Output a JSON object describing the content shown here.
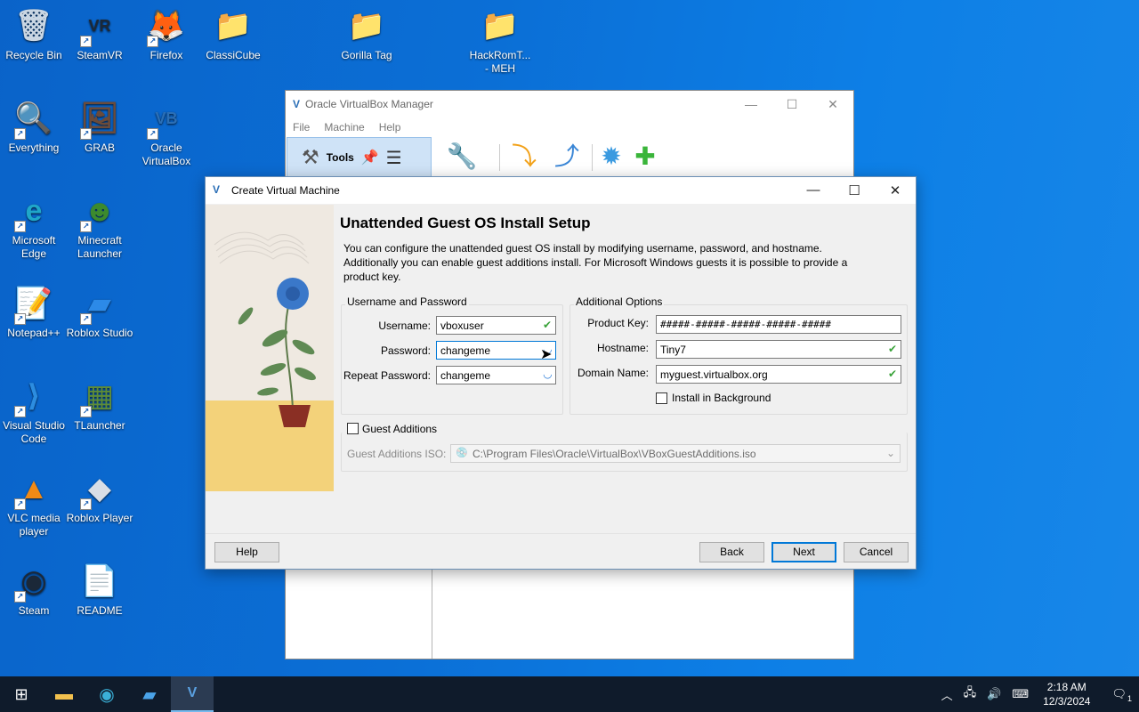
{
  "desktop": {
    "icons": [
      {
        "label": "Recycle Bin",
        "glyph": "🗑",
        "icon": "recycle-bin-icon",
        "shortcut": false
      },
      {
        "label": "SteamVR",
        "glyph": "VR",
        "icon": "steamvr-icon",
        "shortcut": true
      },
      {
        "label": "Firefox",
        "glyph": "🦊",
        "icon": "firefox-icon",
        "shortcut": true
      },
      {
        "label": "ClassiCube",
        "glyph": "📁",
        "icon": "folder-icon",
        "shortcut": false
      },
      {
        "label": "Gorilla Tag",
        "glyph": "📁",
        "icon": "zip-folder-icon",
        "shortcut": false
      },
      {
        "label": "HackRomT...\n- MEH",
        "glyph": "📁",
        "icon": "folder-icon",
        "shortcut": false
      },
      {
        "label": "Everything",
        "glyph": "🔍",
        "icon": "everything-search-icon",
        "shortcut": true
      },
      {
        "label": "GRAB",
        "glyph": "🖼",
        "icon": "grab-image-icon",
        "shortcut": true
      },
      {
        "label": "Oracle VirtualBox",
        "glyph": "VB",
        "icon": "virtualbox-icon",
        "shortcut": true
      },
      {
        "label": "Microsoft Edge",
        "glyph": "e",
        "icon": "edge-icon",
        "shortcut": true
      },
      {
        "label": "Minecraft Launcher",
        "glyph": "☻",
        "icon": "minecraft-icon",
        "shortcut": true
      },
      {
        "label": "Notepad++",
        "glyph": "📝",
        "icon": "notepadpp-icon",
        "shortcut": true
      },
      {
        "label": "Roblox Studio",
        "glyph": "▰",
        "icon": "roblox-studio-icon",
        "shortcut": true
      },
      {
        "label": "Visual Studio Code",
        "glyph": "⟩",
        "icon": "vscode-icon",
        "shortcut": true
      },
      {
        "label": "TLauncher",
        "glyph": "▦",
        "icon": "tlauncher-icon",
        "shortcut": true
      },
      {
        "label": "VLC media player",
        "glyph": "▲",
        "icon": "vlc-icon",
        "shortcut": true
      },
      {
        "label": "Roblox Player",
        "glyph": "◆",
        "icon": "roblox-player-icon",
        "shortcut": true
      },
      {
        "label": "Steam",
        "glyph": "◉",
        "icon": "steam-icon",
        "shortcut": true
      },
      {
        "label": "README",
        "glyph": "📄",
        "icon": "text-file-icon",
        "shortcut": false
      }
    ]
  },
  "vbox_manager": {
    "title": "Oracle VirtualBox Manager",
    "menu": [
      "File",
      "Machine",
      "Help"
    ],
    "tools_label": "Tools"
  },
  "dialog": {
    "title": "Create Virtual Machine",
    "heading": "Unattended Guest OS Install Setup",
    "description": "You can configure the unattended guest OS install by modifying username, password, and hostname. Additionally you can enable guest additions install. For Microsoft Windows guests it is possible to provide a product key.",
    "user_group": {
      "title": "Username and Password",
      "username_label": "Username:",
      "username_value": "vboxuser",
      "password_label": "Password:",
      "password_value": "changeme",
      "repeat_label": "Repeat Password:",
      "repeat_value": "changeme"
    },
    "options_group": {
      "title": "Additional Options",
      "product_key_label": "Product Key:",
      "product_key_value": "#####-#####-#####-#####-#####",
      "hostname_label": "Hostname:",
      "hostname_value": "Tiny7",
      "domain_label": "Domain Name:",
      "domain_value": "myguest.virtualbox.org",
      "install_bg_label": "Install in Background",
      "install_bg_checked": false
    },
    "guest_additions": {
      "label": "Guest Additions",
      "checked": false,
      "iso_label": "Guest Additions ISO:",
      "iso_value": "C:\\Program Files\\Oracle\\VirtualBox\\VBoxGuestAdditions.iso"
    },
    "buttons": {
      "help": "Help",
      "back": "Back",
      "next": "Next",
      "cancel": "Cancel"
    }
  },
  "taskbar": {
    "items": [
      "start-icon",
      "file-explorer-icon",
      "edge-icon",
      "roblox-studio-icon",
      "virtualbox-icon"
    ],
    "clock_time": "2:18 AM",
    "clock_date": "12/3/2024",
    "notification_count": "1"
  },
  "colors": {
    "accent": "#0078d7",
    "desktop": "#0b6fd6",
    "valid": "#3aa33a"
  }
}
